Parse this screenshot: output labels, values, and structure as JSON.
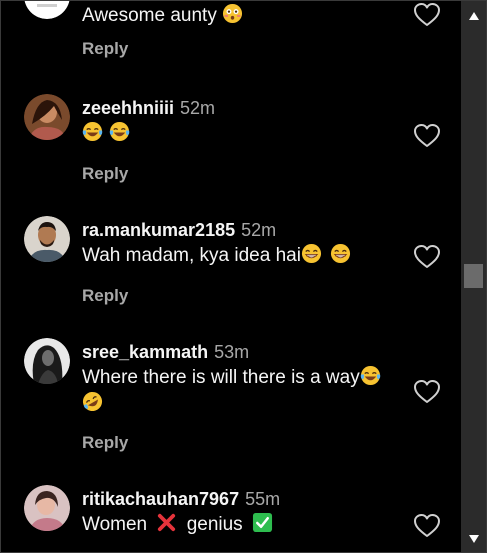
{
  "comments": [
    {
      "username": "",
      "time": "",
      "text": "Awesome aunty",
      "emoji": [
        "flushed-face"
      ],
      "reply_label": "Reply"
    },
    {
      "username": "zeeehhniiii",
      "time": "52m",
      "text": "",
      "emoji": [
        "face-with-tears-of-joy",
        "face-with-tears-of-joy"
      ],
      "reply_label": "Reply"
    },
    {
      "username": "ra.mankumar2185",
      "time": "52m",
      "text": "Wah madam, kya idea hai",
      "emoji": [
        "grinning-face-with-smiling-eyes",
        "grinning-face-with-smiling-eyes"
      ],
      "reply_label": "Reply"
    },
    {
      "username": "sree_kammath",
      "time": "53m",
      "text": "Where there is will there is a way",
      "emoji": [
        "face-with-tears-of-joy",
        "rolling-on-the-floor-laughing"
      ],
      "reply_label": "Reply"
    },
    {
      "username": "ritikachauhan7967",
      "time": "55m",
      "text_parts": [
        "Women",
        "genius"
      ],
      "emoji": [
        "cross-mark",
        "check-mark-button"
      ]
    }
  ],
  "icons": {
    "like": "heart-outline-icon",
    "scroll_up": "triangle-up-icon",
    "scroll_down": "triangle-down-icon"
  },
  "colors": {
    "background": "#000000",
    "text": "#f5f5f5",
    "secondary_text": "#a8a8a8",
    "scrollbar_track": "#2b2b2b",
    "scrollbar_thumb": "#6b6b6b"
  }
}
